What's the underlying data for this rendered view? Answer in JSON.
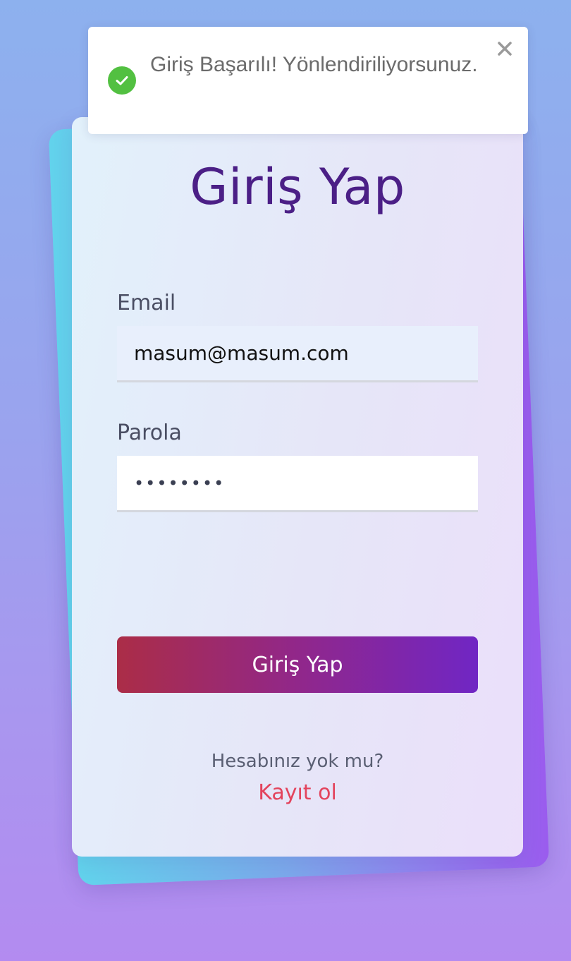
{
  "toast": {
    "message": "Giriş Başarılı! Yönlendiriliyorsunuz.",
    "status": "success",
    "icon": "check-circle-icon",
    "close_icon": "close-icon",
    "success_color": "#52c041"
  },
  "form": {
    "title": "Giriş Yap",
    "email": {
      "label": "Email",
      "value": "masum@masum.com"
    },
    "password": {
      "label": "Parola",
      "value": "••••••••"
    },
    "submit_label": "Giriş Yap",
    "no_account_text": "Hesabınız yok mu?",
    "register_link": "Kayıt ol"
  },
  "colors": {
    "title": "#4b1f86",
    "link": "#e3435c",
    "button_gradient_start": "#ab2d47",
    "button_gradient_end": "#7026c4"
  }
}
